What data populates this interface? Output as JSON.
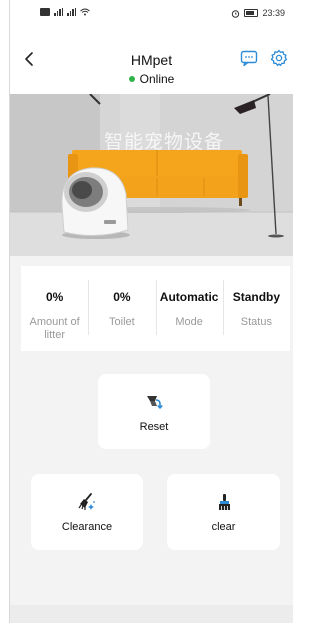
{
  "status_bar": {
    "left_text": "⁴⁶ ²⁶",
    "time": "23:39"
  },
  "header": {
    "title": "HMpet",
    "status": "Online",
    "status_color": "#2fb34a",
    "icons": [
      "back-arrow-icon",
      "message-icon",
      "settings-gear-icon"
    ]
  },
  "hero": {
    "overlay_text": "智能宠物设备"
  },
  "stats": [
    {
      "value": "0%",
      "label": "Amount of litter"
    },
    {
      "value": "0%",
      "label": "Toilet"
    },
    {
      "value": "Automatic",
      "label": "Mode"
    },
    {
      "value": "Standby",
      "label": "Status"
    }
  ],
  "actions": {
    "reset": {
      "label": "Reset",
      "icon": "reset-icon"
    },
    "clearance": {
      "label": "Clearance",
      "icon": "broom-sparkle-icon"
    },
    "clear": {
      "label": "clear",
      "icon": "brush-icon"
    }
  },
  "colors": {
    "accent_blue": "#2e8bd8",
    "online_green": "#2fb34a",
    "sofa_orange": "#f2a21b"
  }
}
